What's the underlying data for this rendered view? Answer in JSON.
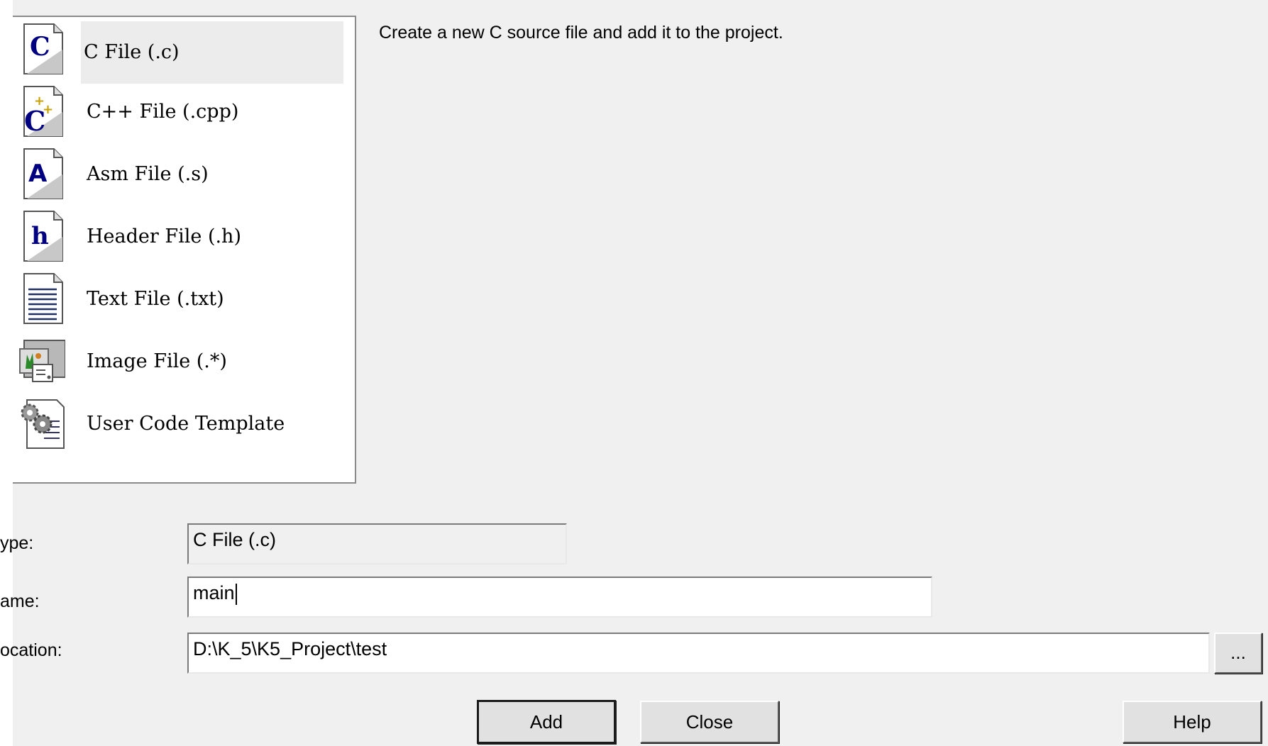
{
  "file_types": [
    {
      "label": "C File (.c)",
      "icon": "c-file-icon",
      "selected": true
    },
    {
      "label": "C++ File (.cpp)",
      "icon": "cpp-file-icon",
      "selected": false
    },
    {
      "label": "Asm File (.s)",
      "icon": "asm-file-icon",
      "selected": false
    },
    {
      "label": "Header File (.h)",
      "icon": "header-file-icon",
      "selected": false
    },
    {
      "label": "Text File (.txt)",
      "icon": "text-file-icon",
      "selected": false
    },
    {
      "label": "Image File (.*)",
      "icon": "image-file-icon",
      "selected": false
    },
    {
      "label": "User Code Template",
      "icon": "user-code-template-icon",
      "selected": false
    }
  ],
  "description": "Create a new C source file and add it to the project.",
  "form": {
    "type_label": "ype:",
    "type_value": "C File (.c)",
    "name_label": "ame:",
    "name_value": "main",
    "location_label": "ocation:",
    "location_value": "D:\\K_5\\K5_Project\\test",
    "browse_label": "..."
  },
  "buttons": {
    "add": "Add",
    "close": "Close",
    "help": "Help"
  }
}
